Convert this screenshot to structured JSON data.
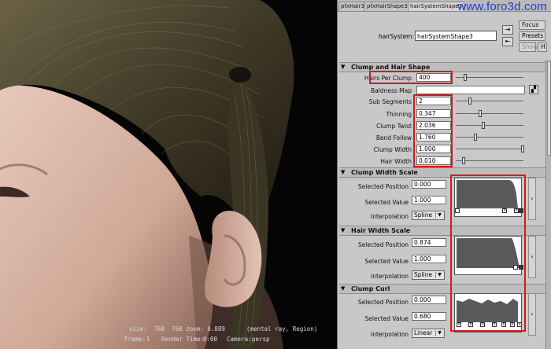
{
  "render": {
    "info_line1": "size:  768  768 zoom: 0.889      (mental ray, Region)",
    "info_frame_label": "Frame:",
    "info_frame_value": "1",
    "info_render_label": "Render Time:",
    "info_render_value": "0:00",
    "info_camera_label": "Camera:",
    "info_camera_value": "persp"
  },
  "tabs": [
    "pfxHair3",
    "pfxHairShape3",
    "hairSystemShape3"
  ],
  "brand": "www.foro3d.com",
  "header": {
    "hairsystem_label": "hairSystem:",
    "hairsystem_value": "hairSystemShape3",
    "focus_label": "Focus",
    "presets_label": "Presets",
    "show_label": "Show",
    "hide_label": "H"
  },
  "clump": {
    "title": "Clump and Hair Shape",
    "hairs_per_clump_label": "Hairs Per Clump",
    "hairs_per_clump_value": "400",
    "baldness_map_label": "Baldness Map",
    "sub_segments_label": "Sub Segments",
    "sub_segments_value": "2",
    "thinning_label": "Thinning",
    "thinning_value": "0.347",
    "clump_twist_label": "Clump Twist",
    "clump_twist_value": "2.036",
    "bend_follow_label": "Bend Follow",
    "bend_follow_value": "1.760",
    "clump_width_label": "Clump Width",
    "clump_width_value": "1.000",
    "hair_width_label": "Hair Width",
    "hair_width_value": "0.010"
  },
  "clump_width_scale": {
    "title": "Clump Width Scale",
    "pos_label": "Selected Position",
    "pos_value": "0.000",
    "val_label": "Selected Value",
    "val_value": "1.000",
    "interp_label": "Interpolation",
    "interp_value": "Spline"
  },
  "hair_width_scale": {
    "title": "Hair Width Scale",
    "pos_label": "Selected Position",
    "pos_value": "0.874",
    "val_label": "Selected Value",
    "val_value": "1.000",
    "interp_label": "Interpolation",
    "interp_value": "Spline"
  },
  "clump_curl": {
    "title": "Clump Curl",
    "pos_label": "Selected Position",
    "pos_value": "0.000",
    "val_label": "Selected Value",
    "val_value": "0.680",
    "interp_label": "Interpolation",
    "interp_value": "Linear"
  },
  "colors": {
    "highlight": "#d21a1a",
    "panel_bg": "#c8c8c8",
    "brand": "#1e3fc8",
    "graph_fill": "#5a5a5a"
  },
  "icons": [
    "collapse-arrow-icon",
    "load-attributes-icon",
    "copy-tab-icon",
    "texture-map-icon",
    "expand-arrow-icon",
    "caret-down-icon"
  ]
}
